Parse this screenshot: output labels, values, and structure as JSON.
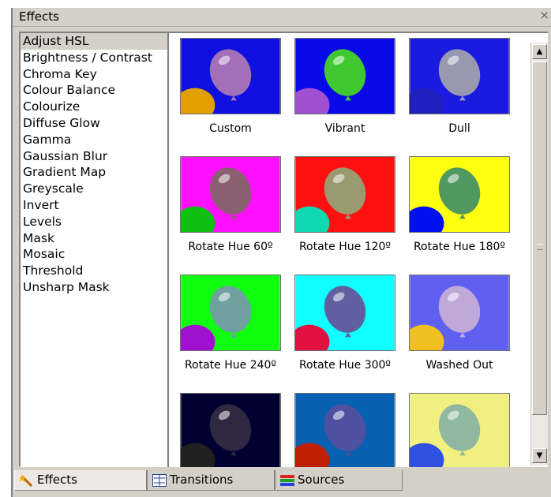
{
  "window": {
    "title": "Effects",
    "close_glyph": "×"
  },
  "effects_list": [
    "Adjust HSL",
    "Brightness / Contrast",
    "Chroma Key",
    "Colour Balance",
    "Colourize",
    "Diffuse Glow",
    "Gamma",
    "Gaussian Blur",
    "Gradient Map",
    "Greyscale",
    "Invert",
    "Levels",
    "Mask",
    "Mosaic",
    "Threshold",
    "Unsharp Mask"
  ],
  "selected_effect": "Adjust HSL",
  "presets": [
    {
      "label": "Custom",
      "bg": "#0f0fe0",
      "balloon": "#a270b8",
      "second": "#e0a000"
    },
    {
      "label": "Vibrant",
      "bg": "#0a0ae8",
      "balloon": "#40c830",
      "second": "#a050d0"
    },
    {
      "label": "Dull",
      "bg": "#1a1ae0",
      "balloon": "#9898b0",
      "second": "#2020c0"
    },
    {
      "label": "Rotate Hue 60º",
      "bg": "#ff10ff",
      "balloon": "#8a6070",
      "second": "#10c010"
    },
    {
      "label": "Rotate Hue 120º",
      "bg": "#ff1010",
      "balloon": "#9a9a70",
      "second": "#10d8b0"
    },
    {
      "label": "Rotate Hue 180º",
      "bg": "#ffff10",
      "balloon": "#509860",
      "second": "#0010f0"
    },
    {
      "label": "Rotate Hue 240º",
      "bg": "#10ff10",
      "balloon": "#70a0a0",
      "second": "#a010d0"
    },
    {
      "label": "Rotate Hue 300º",
      "bg": "#10ffff",
      "balloon": "#6060a0",
      "second": "#e01040"
    },
    {
      "label": "Washed Out",
      "bg": "#6060f0",
      "balloon": "#c0a8d8",
      "second": "#f0c020"
    },
    {
      "label": "",
      "bg": "#000030",
      "balloon": "#302840",
      "second": "#202020"
    },
    {
      "label": "",
      "bg": "#0860b0",
      "balloon": "#5050a0",
      "second": "#c02000"
    },
    {
      "label": "",
      "bg": "#f0f080",
      "balloon": "#90b8a0",
      "second": "#3050e0"
    }
  ],
  "scrollbar": {
    "up_icon": "▲",
    "down_icon": "▼"
  },
  "tabs": [
    {
      "label": "Effects",
      "icon": "effects-wand-icon",
      "active": true
    },
    {
      "label": "Transitions",
      "icon": "transitions-icon",
      "active": false
    },
    {
      "label": "Sources",
      "icon": "sources-icon",
      "active": false
    }
  ]
}
